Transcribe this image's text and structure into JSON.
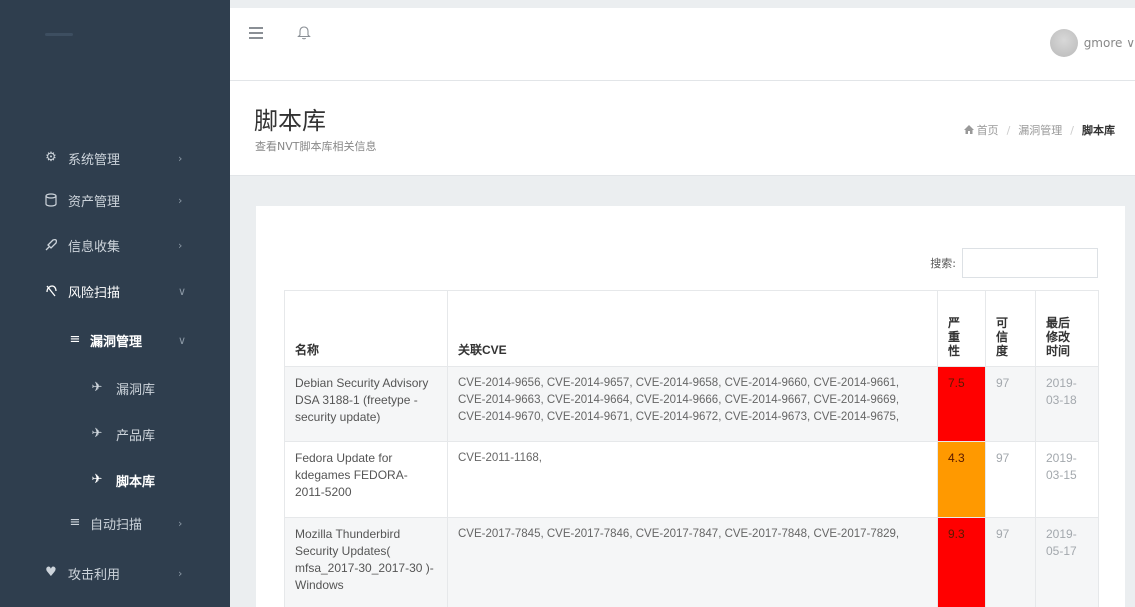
{
  "topbar": {
    "user_name": "gmore ∨"
  },
  "sidebar": {
    "items": [
      {
        "label": "系统管理",
        "icon": "cog-icon",
        "arrow": "›"
      },
      {
        "label": "资产管理",
        "icon": "database-icon",
        "arrow": "›"
      },
      {
        "label": "信息收集",
        "icon": "rocket-icon",
        "arrow": "›"
      },
      {
        "label": "风险扫描",
        "icon": "shield-icon",
        "arrow": "∨"
      },
      {
        "label": "漏洞管理",
        "icon": "list-icon",
        "arrow": "∨"
      },
      {
        "label": "漏洞库",
        "icon": "plane-icon"
      },
      {
        "label": "产品库",
        "icon": "plane-icon"
      },
      {
        "label": "脚本库",
        "icon": "plane-icon"
      },
      {
        "label": "自动扫描",
        "icon": "list-icon",
        "arrow": "›"
      },
      {
        "label": "攻击利用",
        "icon": "heart-icon",
        "arrow": "›"
      }
    ]
  },
  "header": {
    "title": "脚本库",
    "subtitle": "查看NVT脚本库相关信息",
    "breadcrumb": [
      "首页",
      "漏洞管理",
      "脚本库"
    ]
  },
  "search": {
    "label": "搜索:",
    "value": ""
  },
  "table": {
    "columns": [
      "名称",
      "关联CVE",
      "严重性",
      "可信度",
      "最后修改时间"
    ],
    "column_display": [
      "名称",
      "关联CVE",
      "严\n重\n性",
      "可\n信\n度",
      "最后\n修改\n时间"
    ],
    "rows": [
      {
        "name": "Debian Security Advisory DSA 3188-1 (freetype - security update)",
        "cve": "CVE-2014-9656, CVE-2014-9657, CVE-2014-9658, CVE-2014-9660, CVE-2014-9661, CVE-2014-9663, CVE-2014-9664, CVE-2014-9666, CVE-2014-9667, CVE-2014-9669, CVE-2014-9670, CVE-2014-9671, CVE-2014-9672, CVE-2014-9673, CVE-2014-9675,",
        "severity": "7.5",
        "severity_color": "#ff0000",
        "credibility": "97",
        "modified": "2019-03-18"
      },
      {
        "name": "Fedora Update for kdegames FEDORA-2011-5200",
        "cve": "CVE-2011-1168,",
        "severity": "4.3",
        "severity_color": "#ff9900",
        "credibility": "97",
        "modified": "2019-03-15"
      },
      {
        "name": "Mozilla Thunderbird Security Updates( mfsa_2017-30_2017-30 )-Windows",
        "cve": "CVE-2017-7845, CVE-2017-7846, CVE-2017-7847, CVE-2017-7848, CVE-2017-7829,",
        "severity": "9.3",
        "severity_color": "#ff0000",
        "credibility": "97",
        "modified": "2019-05-17"
      }
    ]
  }
}
